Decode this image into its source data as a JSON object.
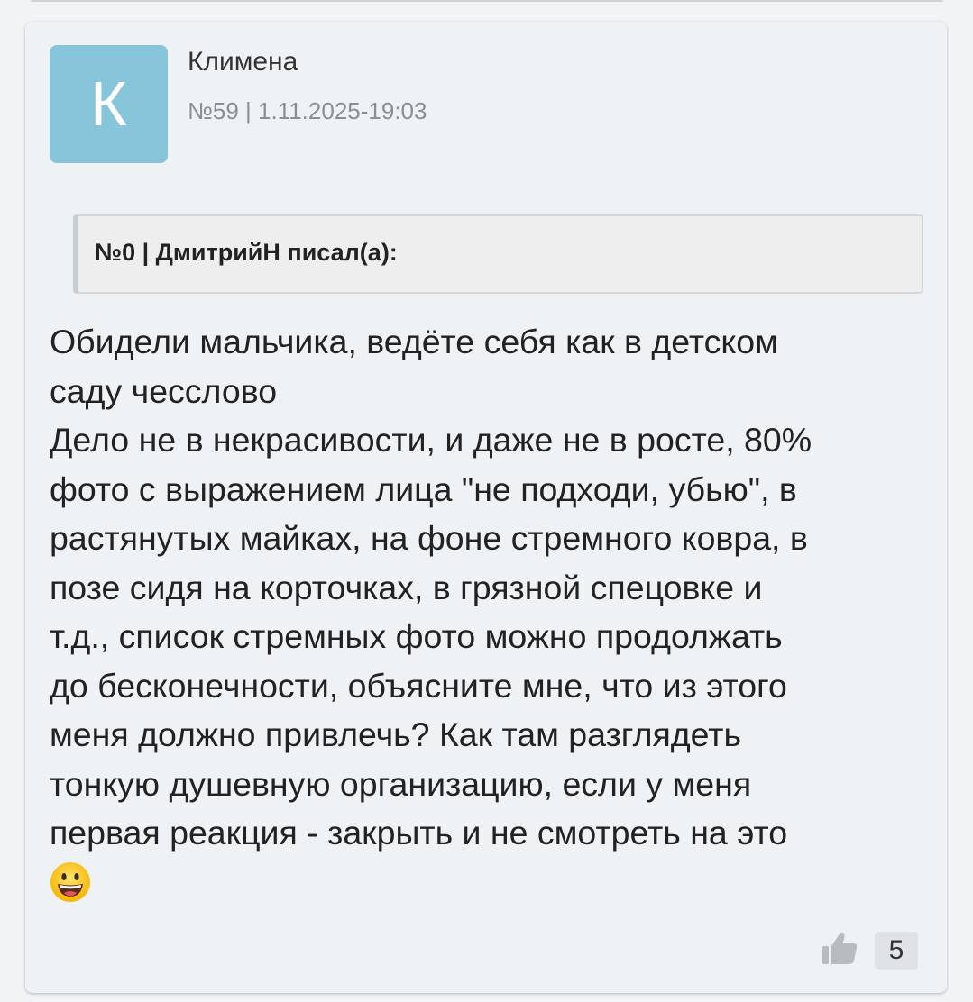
{
  "post": {
    "author_initial": "К",
    "author_name": "Климена",
    "meta": "№59 | 1.11.2025-19:03",
    "quote_header": "№0 | ДмитрийН писал(а):",
    "body_lines": [
      "Обидели мальчика, ведёте себя как в детском",
      "саду чесслово",
      "Дело не в некрасивости, и даже не в росте, 80%",
      "фото с выражением лица \"не подходи, убью\", в",
      "растянутых майках, на фоне стремного ковра, в",
      "позе сидя на корточках, в грязной спецовке и",
      "т.д., список стремных фото можно продолжать",
      "до бесконечности, объясните мне, что из этого",
      "меня должно привлечь? Как там разглядеть",
      "тонкую душевную организацию, если у меня",
      "первая реакция - закрыть и не смотреть на это"
    ],
    "emoji": "grinning-face-icon",
    "like_icon": "thumbs-up-icon",
    "like_count": "5"
  },
  "colors": {
    "avatar_bg": "#87c6da",
    "card_bg": "#eef2f5",
    "quote_bg": "#eeeeee",
    "meta_text": "#8a8f94"
  }
}
